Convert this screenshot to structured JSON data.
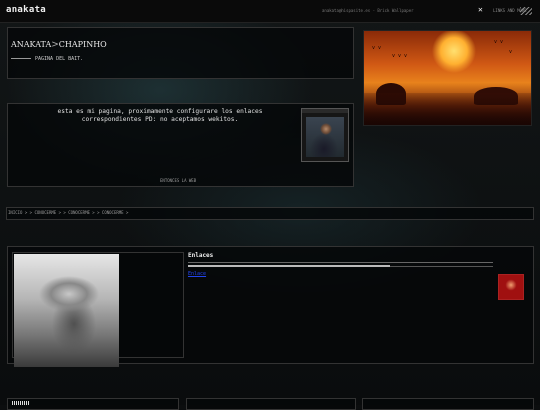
{
  "header": {
    "logo": "anakata",
    "info": "anakata@hispasite.es - Brick Wallpaper",
    "close_icon": "close-icon",
    "link": "LINKS AND MORE"
  },
  "profile": {
    "name": "ANAKATA",
    "separator": ">",
    "subname": "CHAPINHO",
    "subtitle": "PAGINA DEL BAIT."
  },
  "welcome": {
    "text": "esta es mi pagina, proximamente configurare los enlaces correspondientes PD: no aceptamos wekitos.",
    "footer_link": "ENTONCES LA WEB"
  },
  "breadcrumb": "INICIO > > CONOCERME > > CONOCERME > > CONOCERME >",
  "enlaces": {
    "title": "Enlaces",
    "link": "Enlace"
  },
  "icons": [
    "close-icon",
    "stripes-icon"
  ],
  "colors": {
    "accent": "#e8821c",
    "link": "#2244ee"
  }
}
